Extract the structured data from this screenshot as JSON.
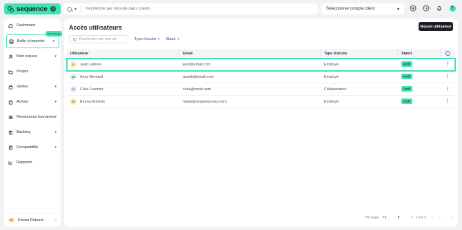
{
  "brand": {
    "name": "sequence",
    "badge": "S"
  },
  "topbar": {
    "search_placeholder": "Recherche par mot-clé dans clients",
    "client_select": "Sélectionner compte client"
  },
  "sidebar": {
    "new_badge": "Nouveau",
    "items": [
      {
        "label": "Dashboard",
        "icon": "home-icon"
      },
      {
        "label": "Boîte à importer",
        "icon": "inbox-icon"
      },
      {
        "label": "Mon espace",
        "icon": "user-icon"
      },
      {
        "label": "Projets",
        "icon": "folder-icon"
      },
      {
        "label": "Ventes",
        "icon": "bag-icon"
      },
      {
        "label": "Achats",
        "icon": "cart-icon"
      },
      {
        "label": "Ressources humaines",
        "icon": "people-icon"
      },
      {
        "label": "Banking",
        "icon": "bank-icon"
      },
      {
        "label": "Comptabilité",
        "icon": "ledger-icon"
      },
      {
        "label": "Rapports",
        "icon": "chart-icon"
      }
    ],
    "user": {
      "initials": "ER",
      "name": "Emma Roberts"
    }
  },
  "main": {
    "title": "Accès utilisateurs",
    "new_button": "Nouvel utilisateur",
    "filter_search_placeholder": "Recherche par mot clé",
    "filter_access": "Type d'accès",
    "filter_status": "Statut",
    "columns": [
      "Utilisateur",
      "Email",
      "Type d'accès",
      "Statut"
    ],
    "rows": [
      {
        "initials": "JL",
        "name": "Jean Lefevre",
        "email": "jean@email.com",
        "access": "Employé",
        "status": "Actif"
      },
      {
        "initials": "AB",
        "name": "Anne Bernard",
        "email": "anneb@email.com",
        "access": "Employé",
        "status": "Actif"
      },
      {
        "initials": "CL",
        "name": "Célia Fournier",
        "email": "celia@email.com",
        "access": "Collaborateur",
        "status": "Actif"
      },
      {
        "initials": "ER",
        "name": "Emma Roberts",
        "email": "maria@sequence-erp.com",
        "access": "Employé",
        "status": "Actif"
      }
    ],
    "pagination": {
      "per_page_label": "Par page",
      "per_page": "10",
      "range": "1 - 4 sur 4"
    }
  },
  "colors": {
    "accent": "#43e0b3",
    "dark_button": "#1d1f24",
    "link_blue": "#2a4f9e"
  }
}
